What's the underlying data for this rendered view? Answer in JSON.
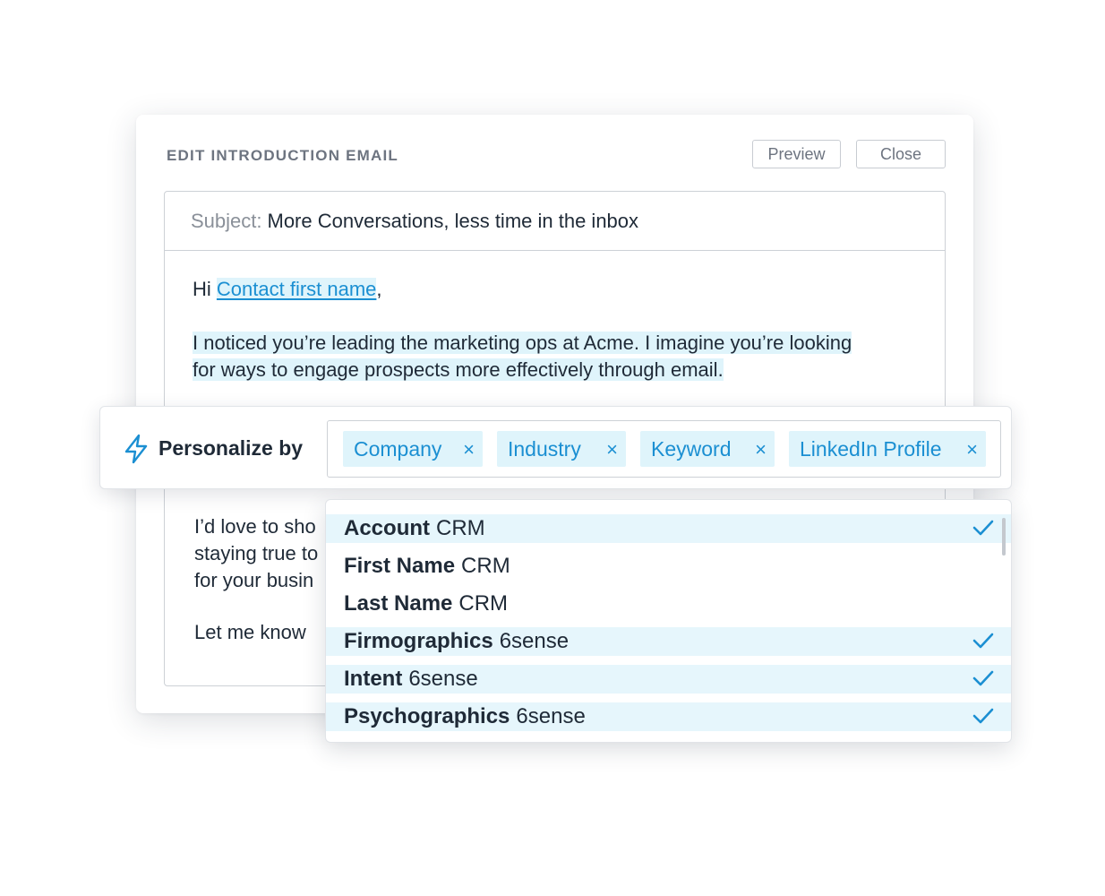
{
  "card": {
    "title": "EDIT INTRODUCTION EMAIL",
    "preview_label": "Preview",
    "close_label": "Close"
  },
  "email": {
    "subject_label": "Subject:",
    "subject_value": "More Conversations, less time in the inbox",
    "greeting": "Hi",
    "contact_token": "Contact first name",
    "greeting_punct": ",",
    "para1_line1": "I noticed you’re leading the marketing ops at Acme. I imagine you’re looking",
    "para1_line2": "for ways to engage prospects more effectively through email.",
    "para2_line1": "I’d love to sho",
    "para2_line2": "staying true to",
    "para2_line3": "for your busin",
    "para3_line1": "Let me know"
  },
  "personalize": {
    "label": "Personalize by",
    "chips": [
      {
        "label": "Company",
        "remove": "×"
      },
      {
        "label": "Industry",
        "remove": "×"
      },
      {
        "label": "Keyword",
        "remove": "×"
      },
      {
        "label": "LinkedIn Profile",
        "remove": "×"
      }
    ]
  },
  "dropdown": {
    "options": [
      {
        "name": "Account",
        "source": "CRM",
        "selected": true
      },
      {
        "name": "First Name",
        "source": "CRM",
        "selected": false
      },
      {
        "name": "Last Name",
        "source": "CRM",
        "selected": false
      },
      {
        "name": "Firmographics",
        "source": "6sense",
        "selected": true
      },
      {
        "name": "Intent",
        "source": "6sense",
        "selected": true
      },
      {
        "name": "Psychographics",
        "source": "6sense",
        "selected": true
      }
    ]
  },
  "colors": {
    "accent": "#1b8fd2",
    "highlight": "#dff4fb",
    "text": "#1f2a37",
    "muted": "#6d7480"
  }
}
